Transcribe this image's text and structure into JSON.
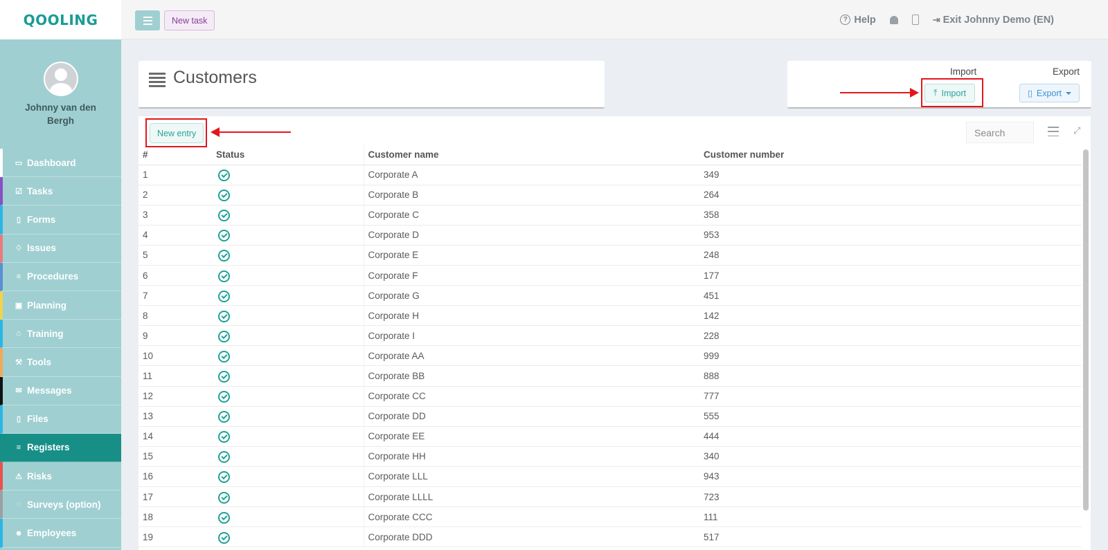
{
  "app": {
    "logo": "QOOLING"
  },
  "profile": {
    "name": "Johnny van den Bergh"
  },
  "sidebar": {
    "items": [
      {
        "label": "Dashboard",
        "icon": "monitor-icon",
        "accent": "#ffffff",
        "glyph": "▭"
      },
      {
        "label": "Tasks",
        "icon": "checkbox-icon",
        "accent": "#8a4fc4",
        "glyph": "☑"
      },
      {
        "label": "Forms",
        "icon": "document-icon",
        "accent": "#2cb6e5",
        "glyph": "▯"
      },
      {
        "label": "Issues",
        "icon": "bell-icon",
        "accent": "#ea7b7b",
        "glyph": "♢"
      },
      {
        "label": "Procedures",
        "icon": "list-icon",
        "accent": "#5a8fd6",
        "glyph": "≡"
      },
      {
        "label": "Planning",
        "icon": "calendar-icon",
        "accent": "#f1d34a",
        "glyph": "▣"
      },
      {
        "label": "Training",
        "icon": "graduation-cap-icon",
        "accent": "#2cb6e5",
        "glyph": "⌂"
      },
      {
        "label": "Tools",
        "icon": "wrench-icon",
        "accent": "#f0a95a",
        "glyph": "⚒"
      },
      {
        "label": "Messages",
        "icon": "envelope-icon",
        "accent": "#111111",
        "glyph": "✉"
      },
      {
        "label": "Files",
        "icon": "pdf-file-icon",
        "accent": "#2cb6e5",
        "glyph": "▯"
      },
      {
        "label": "Registers",
        "icon": "list-icon",
        "accent": "#178f87",
        "glyph": "≡",
        "active": true
      },
      {
        "label": "Risks",
        "icon": "warning-icon",
        "accent": "#e9524e",
        "glyph": "⚠"
      },
      {
        "label": "Surveys (option)",
        "icon": "comment-icon",
        "accent": "#9aa0a5",
        "glyph": "◌"
      },
      {
        "label": "Employees",
        "icon": "users-icon",
        "accent": "#2cb6e5",
        "glyph": "☻"
      }
    ]
  },
  "topbar": {
    "new_task_label": "New task",
    "help_label": "Help",
    "exit_label": "Exit Johnny Demo (EN)"
  },
  "header": {
    "title": "Customers"
  },
  "import_export": {
    "import_heading": "Import",
    "export_heading": "Export",
    "import_button": "Import",
    "export_button": "Export"
  },
  "toolbar": {
    "new_entry_label": "New entry",
    "search_placeholder": "Search"
  },
  "table": {
    "headers": [
      "#",
      "Status",
      "Customer name",
      "Customer number"
    ],
    "rows": [
      {
        "num": "1",
        "status": "active",
        "name": "Corporate A",
        "number": "349"
      },
      {
        "num": "2",
        "status": "active",
        "name": "Corporate B",
        "number": "264"
      },
      {
        "num": "3",
        "status": "active",
        "name": "Corporate C",
        "number": "358"
      },
      {
        "num": "4",
        "status": "active",
        "name": "Corporate D",
        "number": "953"
      },
      {
        "num": "5",
        "status": "active",
        "name": "Corporate E",
        "number": "248"
      },
      {
        "num": "6",
        "status": "active",
        "name": "Corporate F",
        "number": "177"
      },
      {
        "num": "7",
        "status": "active",
        "name": "Corporate G",
        "number": "451"
      },
      {
        "num": "8",
        "status": "active",
        "name": "Corporate H",
        "number": "142"
      },
      {
        "num": "9",
        "status": "active",
        "name": "Corporate I",
        "number": "228"
      },
      {
        "num": "10",
        "status": "active",
        "name": "Corporate AA",
        "number": "999"
      },
      {
        "num": "11",
        "status": "active",
        "name": "Corporate BB",
        "number": "888"
      },
      {
        "num": "12",
        "status": "active",
        "name": "Corporate CC",
        "number": "777"
      },
      {
        "num": "13",
        "status": "active",
        "name": "Corporate DD",
        "number": "555"
      },
      {
        "num": "14",
        "status": "active",
        "name": "Corporate EE",
        "number": "444"
      },
      {
        "num": "15",
        "status": "active",
        "name": "Corporate HH",
        "number": "340"
      },
      {
        "num": "16",
        "status": "active",
        "name": "Corporate LLL",
        "number": "943"
      },
      {
        "num": "17",
        "status": "active",
        "name": "Corporate LLLL",
        "number": "723"
      },
      {
        "num": "18",
        "status": "active",
        "name": "Corporate CCC",
        "number": "111"
      },
      {
        "num": "19",
        "status": "active",
        "name": "Corporate DDD",
        "number": "517"
      }
    ]
  },
  "colors": {
    "brand": "#1a9c94",
    "sidebar_bg": "#9fcfd1",
    "active_nav": "#178f87",
    "annotation_red": "#e4161b"
  }
}
